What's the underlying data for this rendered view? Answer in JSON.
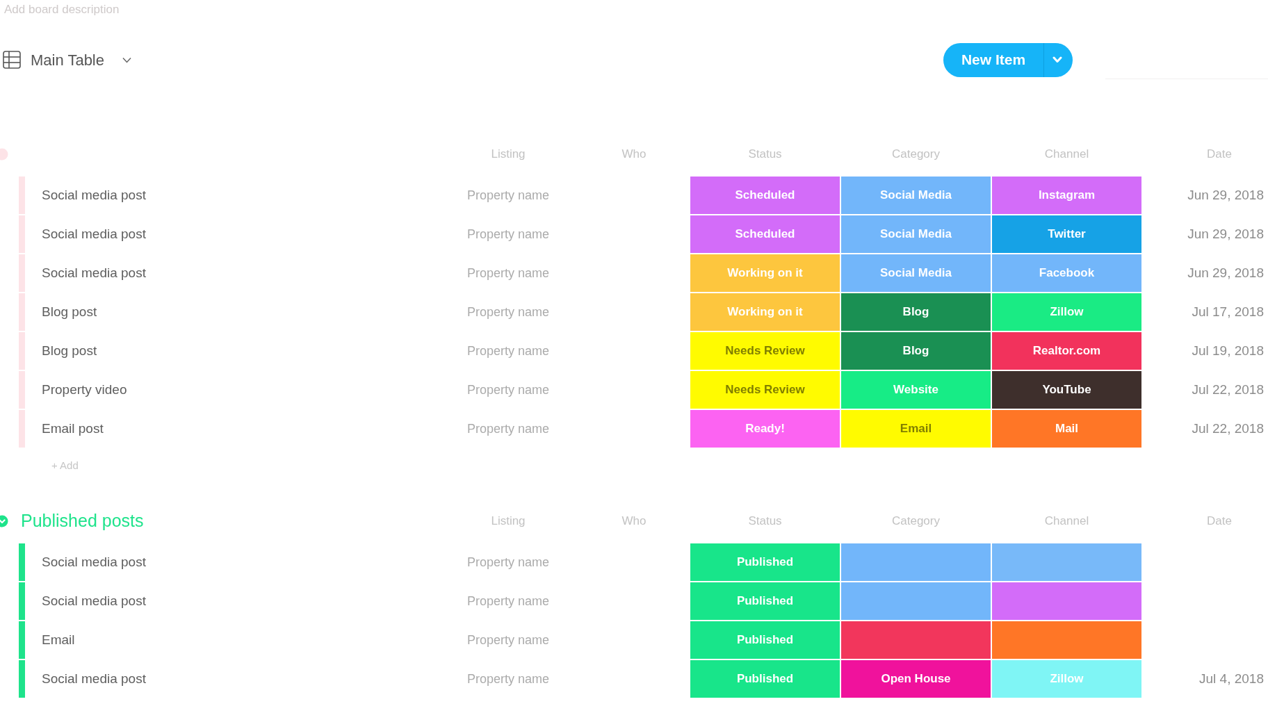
{
  "description": {
    "placeholder": "Add board description"
  },
  "view": {
    "label": "Main Table"
  },
  "new_item": {
    "label": "New Item"
  },
  "groups": [
    {
      "color": "#fde3e7",
      "columns": [
        "Listing",
        "Who",
        "Status",
        "Category",
        "Channel",
        "Date"
      ],
      "rows": [
        {
          "name": "Social media post",
          "listing": "Property name",
          "status": {
            "label": "Scheduled",
            "color": "#d36cf9"
          },
          "category": {
            "label": "Social Media",
            "color": "#72b6fa"
          },
          "channel": {
            "label": "Instagram",
            "color": "#d36cf9"
          },
          "date": "Jun 29, 2018"
        },
        {
          "name": "Social media post",
          "listing": "Property name",
          "status": {
            "label": "Scheduled",
            "color": "#d36cf9"
          },
          "category": {
            "label": "Social Media",
            "color": "#72b6fa"
          },
          "channel": {
            "label": "Twitter",
            "color": "#16a2e6"
          },
          "date": "Jun 29, 2018"
        },
        {
          "name": "Social media post",
          "listing": "Property name",
          "status": {
            "label": "Working on it",
            "color": "#fdc63e"
          },
          "category": {
            "label": "Social Media",
            "color": "#72b6fa"
          },
          "channel": {
            "label": "Facebook",
            "color": "#72b6fa"
          },
          "date": "Jun 29, 2018"
        },
        {
          "name": "Blog post",
          "listing": "Property name",
          "status": {
            "label": "Working on it",
            "color": "#fdc63e"
          },
          "category": {
            "label": "Blog",
            "color": "#1a9053"
          },
          "channel": {
            "label": "Zillow",
            "color": "#1aeb84"
          },
          "date": "Jul 17, 2018"
        },
        {
          "name": "Blog post",
          "listing": "Property name",
          "status": {
            "label": "Needs Review",
            "color": "#fffb00"
          },
          "category": {
            "label": "Blog",
            "color": "#1a9053"
          },
          "channel": {
            "label": "Realtor.com",
            "color": "#f2325c"
          },
          "date": "Jul 19, 2018"
        },
        {
          "name": "Property video",
          "listing": "Property name",
          "status": {
            "label": "Needs Review",
            "color": "#fffb00"
          },
          "category": {
            "label": "Website",
            "color": "#17ec86"
          },
          "channel": {
            "label": "YouTube",
            "color": "#3e2f2c"
          },
          "date": "Jul 22, 2018"
        },
        {
          "name": "Email post",
          "listing": "Property name",
          "status": {
            "label": "Ready!",
            "color": "#fc63f2"
          },
          "category": {
            "label": "Email",
            "color": "#fffb00"
          },
          "channel": {
            "label": "Mail",
            "color": "#ff7626"
          },
          "date": "Jul 22, 2018"
        }
      ],
      "add_label": "+ Add"
    },
    {
      "title": "Published posts",
      "color": "#1ee38b",
      "columns": [
        "Listing",
        "Who",
        "Status",
        "Category",
        "Channel",
        "Date"
      ],
      "rows": [
        {
          "name": "Social media post",
          "listing": "Property name",
          "status": {
            "label": "Published",
            "color": "#18e58a"
          },
          "category": {
            "color": "#72b6fa"
          },
          "channel": {
            "color": "#78b9f9"
          }
        },
        {
          "name": "Social media post",
          "listing": "Property name",
          "status": {
            "label": "Published",
            "color": "#18e58a"
          },
          "category": {
            "color": "#72b6fa"
          },
          "channel": {
            "color": "#d36cf9"
          }
        },
        {
          "name": "Email",
          "listing": "Property name",
          "status": {
            "label": "Published",
            "color": "#18e58a"
          },
          "category": {
            "color": "#f2365c"
          },
          "channel": {
            "color": "#ff7626"
          }
        },
        {
          "name": "Social media post",
          "listing": "Property name",
          "status": {
            "label": "Published",
            "color": "#18e58a"
          },
          "category": {
            "label": "Open House",
            "color": "#f0129c"
          },
          "channel": {
            "label": "Zillow",
            "color": "#7ff5f5"
          },
          "date": "Jul 4, 2018"
        }
      ]
    }
  ]
}
